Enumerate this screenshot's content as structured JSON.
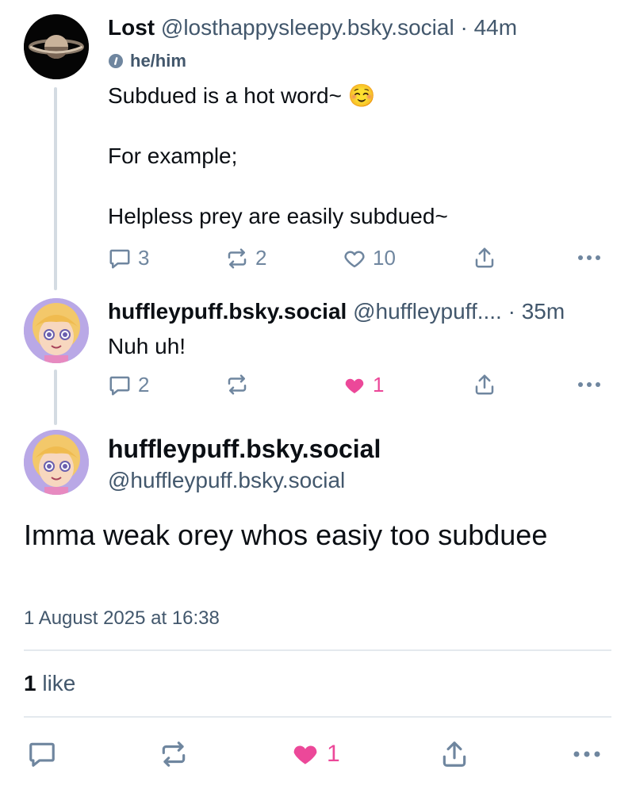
{
  "post1": {
    "author_name": "Lost",
    "author_handle": "@losthappysleepy.bsky.social",
    "time": "· 44m",
    "pronouns": "he/him",
    "text": "Subdued is a hot word~ ☺️\n\nFor example;\n\nHelpless prey are easily subdued~",
    "replies": "3",
    "reposts": "2",
    "likes": "10"
  },
  "post2": {
    "author_name": "huffleypuff.bsky.social",
    "author_handle": "@huffleypuff....",
    "time": "· 35m",
    "text": "Nuh uh!",
    "replies": "2",
    "likes": "1"
  },
  "main_post": {
    "author_name": "huffleypuff.bsky.social",
    "author_handle": "@huffleypuff.bsky.social",
    "text": "Imma weak orey whos easiy too subduee",
    "timestamp": "1 August 2025 at 16:38",
    "like_count_number": "1",
    "like_count_label": "like",
    "likes": "1"
  },
  "icons": {
    "reply": "speech-bubble-icon",
    "repost": "repost-arrows-icon",
    "like": "heart-icon",
    "share": "share-upload-icon",
    "more": "more-dots-icon",
    "pronoun_badge": "info-badge-icon"
  },
  "colors": {
    "accent_like": "#ec4899",
    "icon_gray": "#6f869f",
    "handle_gray": "#42576c",
    "thread_line": "#d4dbe2"
  }
}
